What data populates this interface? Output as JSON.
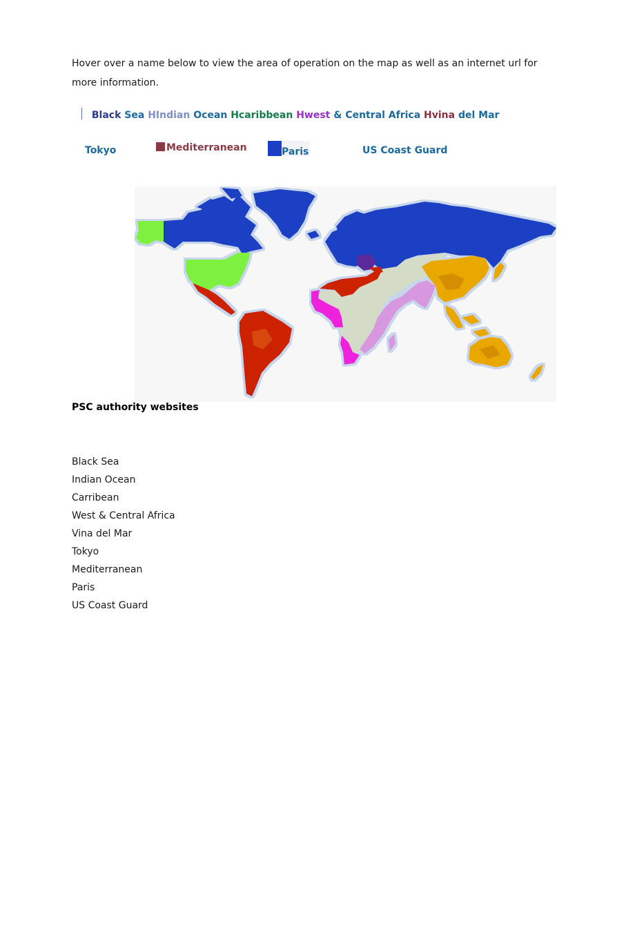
{
  "intro": {
    "text": "Hover over a name below to view the area of operation on the map as well as an internet url for more information."
  },
  "link_bar_top": {
    "items": [
      {
        "label": "Black",
        "color": "#2e3a8c"
      },
      {
        "label": "Sea",
        "color": "#1a6aa0"
      },
      {
        "label": "HIndian",
        "color": "#7d8fc9"
      },
      {
        "label": "Ocean",
        "color": "#1a6aa0"
      },
      {
        "label": "Hcaribbean",
        "color": "#167a4a"
      },
      {
        "label": "Hwest",
        "color": "#9b2fc9"
      },
      {
        "label": "& Central Africa",
        "color": "#1a6aa0"
      },
      {
        "label": "Hvina",
        "color": "#8a3040"
      },
      {
        "label": "del Mar",
        "color": "#1a6aa0"
      }
    ]
  },
  "link_bar_bottom": {
    "items": [
      {
        "label": "Tokyo",
        "color": "#1a6aa0"
      },
      {
        "label": "Mediterranean",
        "color": "#8a3a44",
        "swatch": "#8a3a44"
      },
      {
        "label": "Paris",
        "color": "#1a6aa0",
        "swatch": "#1a3fc4"
      },
      {
        "label": "US Coast Guard",
        "color": "#1a6aa0"
      }
    ]
  },
  "map": {
    "label": "World map of PSC areas of operation",
    "region_colors": {
      "paris": "#1a3fc4",
      "us_coast_guard": "#7ef040",
      "vina_del_mar": "#cc2200",
      "mediterranean": "#cc2200",
      "west_central_africa": "#ee22dd",
      "indian_ocean": "#d898e0",
      "tokyo": "#e8a800",
      "black_sea": "#5a2a9a",
      "caribbean": "#1a8a3a",
      "other_land": "#d4dcc8"
    }
  },
  "psc": {
    "heading": "PSC authority websites",
    "links": [
      "Black Sea",
      "Indian Ocean",
      "Carribean",
      "West & Central Africa",
      "Vina del Mar",
      "Tokyo",
      "Mediterranean",
      "Paris",
      "US Coast Guard"
    ]
  }
}
